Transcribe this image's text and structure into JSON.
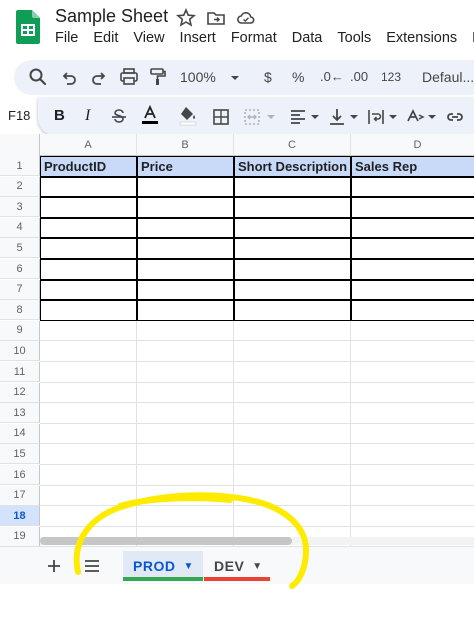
{
  "document": {
    "title": "Sample Sheet"
  },
  "menu": [
    "File",
    "Edit",
    "View",
    "Insert",
    "Format",
    "Data",
    "Tools",
    "Extensions",
    "He"
  ],
  "toolbar": {
    "zoom": "100%",
    "currency": "$",
    "percent": "%",
    "decrease_decimal": ".0←",
    "increase_decimal": ".00",
    "number_format": "123",
    "font": "Defaul..."
  },
  "name_box": "F18",
  "columns": [
    "A",
    "B",
    "C",
    "D"
  ],
  "rows": [
    "1",
    "2",
    "3",
    "4",
    "5",
    "6",
    "7",
    "8",
    "9",
    "10",
    "11",
    "12",
    "13",
    "14",
    "15",
    "16",
    "17",
    "18",
    "19"
  ],
  "active_row": "18",
  "table": {
    "headers": [
      "ProductID",
      "Price",
      "Short Description",
      "Sales Rep"
    ],
    "rows": [
      [
        "",
        "",
        "",
        ""
      ],
      [
        "",
        "",
        "",
        ""
      ],
      [
        "",
        "",
        "",
        ""
      ],
      [
        "",
        "",
        "",
        ""
      ],
      [
        "",
        "",
        "",
        ""
      ],
      [
        "",
        "",
        "",
        ""
      ],
      [
        "",
        "",
        "",
        ""
      ]
    ]
  },
  "sheets": [
    {
      "name": "PROD",
      "active": true,
      "color": "#34a853"
    },
    {
      "name": "DEV",
      "active": false,
      "color": "#ea4335"
    }
  ],
  "colors": {
    "header_fill": "#c9daf8",
    "accent": "#0b57d0",
    "annotation": "#ffeb00"
  }
}
